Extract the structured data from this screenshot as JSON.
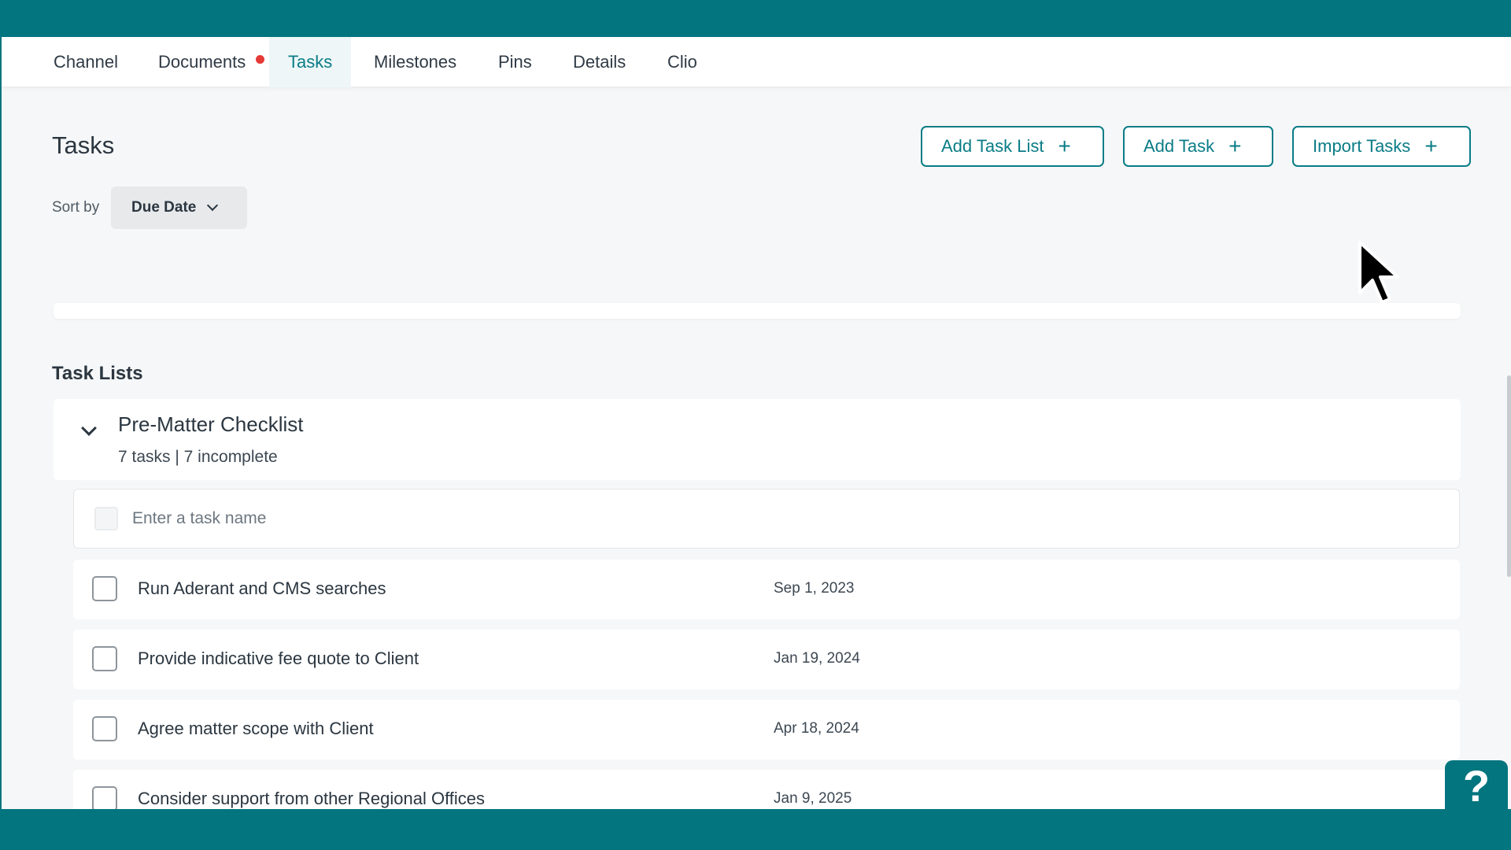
{
  "tabs": [
    {
      "label": "Channel"
    },
    {
      "label": "Documents",
      "has_notification": true
    },
    {
      "label": "Tasks",
      "active": true
    },
    {
      "label": "Milestones"
    },
    {
      "label": "Pins"
    },
    {
      "label": "Details"
    },
    {
      "label": "Clio"
    }
  ],
  "page": {
    "title": "Tasks",
    "buttons": {
      "add_task_list": "Add Task List",
      "add_task": "Add Task",
      "import_tasks": "Import Tasks"
    },
    "sort": {
      "label": "Sort by",
      "selected": "Due Date"
    }
  },
  "task_lists": {
    "section_title": "Task Lists",
    "list": {
      "name": "Pre-Matter Checklist",
      "meta": "7 tasks | 7 incomplete",
      "new_task_placeholder": "Enter a task name",
      "tasks": [
        {
          "name": "Run Aderant and CMS searches",
          "due": "Sep 1, 2023"
        },
        {
          "name": "Provide indicative fee quote to Client",
          "due": "Jan 19, 2024"
        },
        {
          "name": "Agree matter scope with Client",
          "due": "Apr 18, 2024"
        },
        {
          "name": "Consider support from other Regional Offices",
          "due": "Jan 9, 2025"
        }
      ]
    }
  },
  "help": {
    "label": "?"
  },
  "colors": {
    "brand": "#02757f",
    "accent": "#0a7c86",
    "notification": "#e53935"
  }
}
